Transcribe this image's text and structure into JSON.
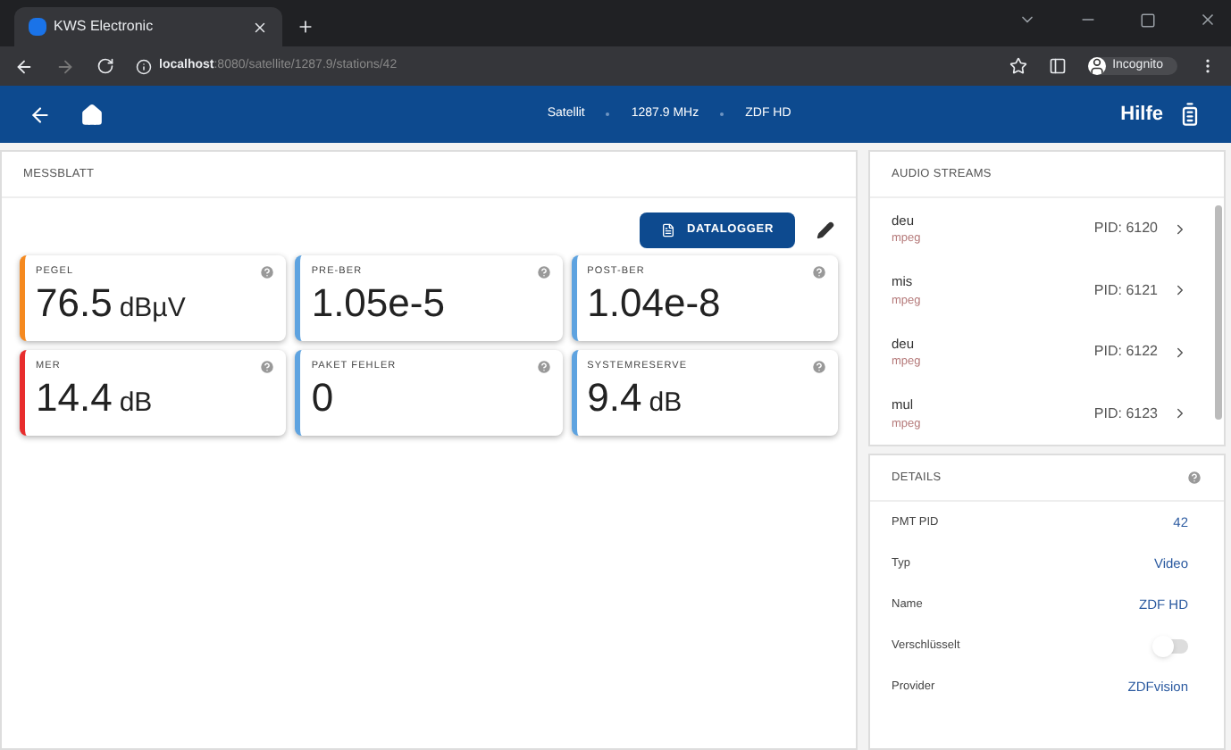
{
  "browser": {
    "tab_title": "KWS Electronic",
    "url_host": "localhost",
    "url_path": ":8080/satellite/1287.9/stations/42",
    "profile": "Incognito"
  },
  "header": {
    "crumbs": [
      "Satellit",
      "1287.9 MHz",
      "ZDF HD"
    ],
    "help": "Hilfe"
  },
  "messblatt": {
    "title": "MESSBLATT",
    "datalogger": "DATALOGGER",
    "cards": [
      {
        "label": "PEGEL",
        "value": "76.5",
        "unit": "dBµV",
        "color": "#f5891f"
      },
      {
        "label": "PRE-BER",
        "value": "1.05e-5",
        "color": "#5ea3e0"
      },
      {
        "label": "POST-BER",
        "value": "1.04e-8",
        "color": "#5ea3e0"
      },
      {
        "label": "MER",
        "value": "14.4",
        "unit": "dB",
        "color": "#e82d2d"
      },
      {
        "label": "PAKET FEHLER",
        "value": "0",
        "color": "#5ea3e0"
      },
      {
        "label": "SYSTEMRESERVE",
        "value": "9.4",
        "unit": "dB",
        "color": "#5ea3e0"
      }
    ]
  },
  "audio_streams": {
    "title": "AUDIO STREAMS",
    "items": [
      {
        "language": "deu",
        "codec": "mpeg",
        "pid": "PID: 6120"
      },
      {
        "language": "mis",
        "codec": "mpeg",
        "pid": "PID: 6121"
      },
      {
        "language": "deu",
        "codec": "mpeg",
        "pid": "PID: 6122"
      },
      {
        "language": "mul",
        "codec": "mpeg",
        "pid": "PID: 6123"
      }
    ]
  },
  "details": {
    "title": "DETAILS",
    "rows": [
      {
        "kind": "text",
        "label": "PMT PID",
        "value": "42"
      },
      {
        "kind": "text",
        "label": "Typ",
        "value": "Video"
      },
      {
        "kind": "text",
        "label": "Name",
        "value": "ZDF HD"
      },
      {
        "kind": "switch",
        "label": "Verschlüsselt",
        "on": false
      },
      {
        "kind": "text",
        "label": "Provider",
        "value": "ZDFvision"
      }
    ]
  }
}
